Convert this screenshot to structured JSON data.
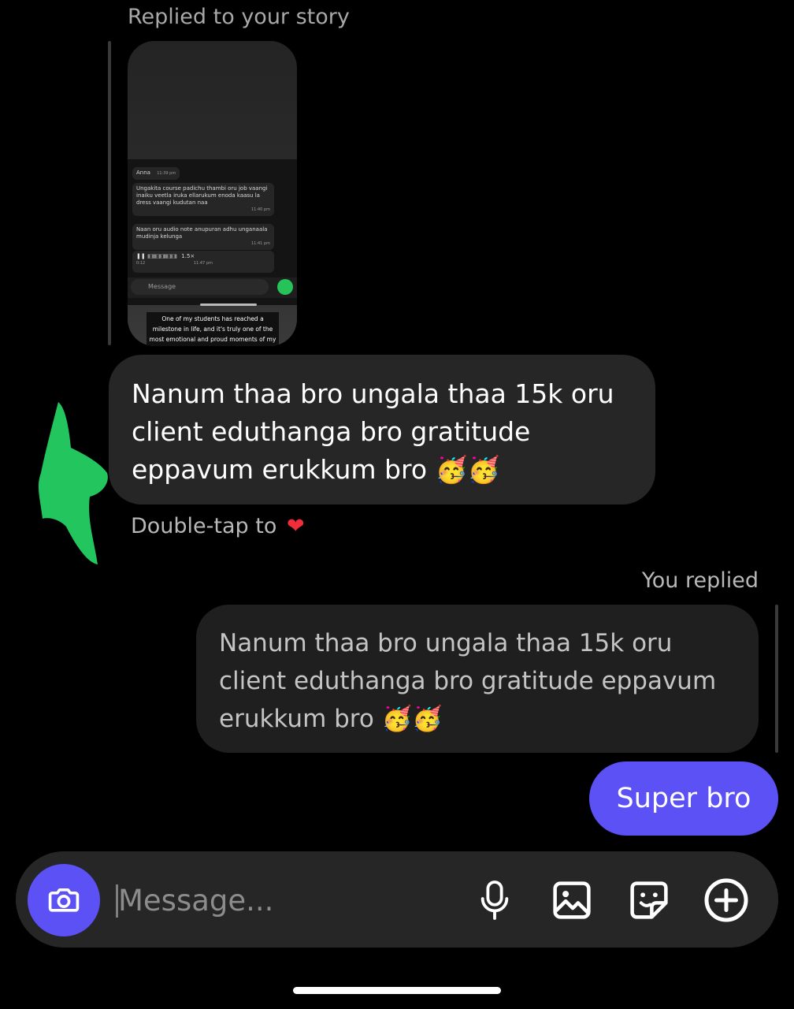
{
  "story": {
    "label": "Replied to your story",
    "screenshot": {
      "name": "Anna",
      "name_time": "11:39 pm",
      "message1": "Ungakita course padichu thambi oru job vaangi inaiku veetla iruka ellarukum enoda kaasu la dress vaangi kudutan naa",
      "message1_time": "11:40 pm",
      "message2": "Naan oru audio note anupuran adhu unganaala mudinja kelunga",
      "message2_time": "11:41 pm",
      "audio_elapsed": "0:12",
      "audio_speed": "1.5×",
      "audio_time": "11:47 pm",
      "input_placeholder": "Message"
    },
    "caption": "One of my students has reached a milestone in life, and it's truly one of the most emotional and proud moments of my journey.❤️"
  },
  "incoming": {
    "text": "Nanum thaa bro ungala thaa 15k oru client eduthanga bro gratitude eppavum erukkum bro 🥳🥳",
    "double_tap_hint": "Double-tap to",
    "hint_icon": "heart-icon"
  },
  "outgoing": {
    "you_replied_label": "You replied",
    "quoted_text": "Nanum thaa bro ungala thaa 15k oru client eduthanga bro gratitude eppavum erukkum bro 🥳🥳",
    "message": "Super bro"
  },
  "composer": {
    "placeholder": "Message...",
    "icons": [
      "camera-icon",
      "microphone-icon",
      "gallery-icon",
      "sticker-icon",
      "add-icon"
    ]
  },
  "colors": {
    "accent": "#5b51f5",
    "bubble_incoming": "#262626",
    "bubble_quote": "#1f1f1f",
    "background": "#000000",
    "reaction_mark": "#22c55e"
  }
}
